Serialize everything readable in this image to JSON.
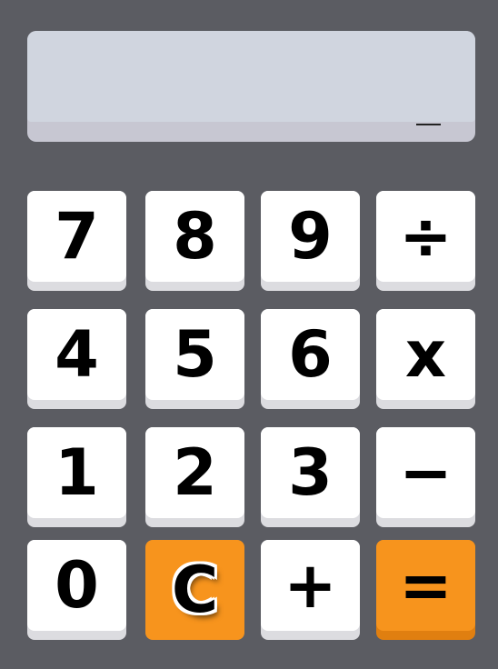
{
  "display": {
    "value": "",
    "cursor": "_"
  },
  "keys": [
    {
      "label": "7"
    },
    {
      "label": "8"
    },
    {
      "label": "9"
    },
    {
      "label": "÷"
    },
    {
      "label": "4"
    },
    {
      "label": "5"
    },
    {
      "label": "6"
    },
    {
      "label": "x"
    },
    {
      "label": "1"
    },
    {
      "label": "2"
    },
    {
      "label": "3"
    },
    {
      "label": "−"
    },
    {
      "label": "0"
    },
    {
      "label": "C"
    },
    {
      "label": "+"
    },
    {
      "label": "="
    }
  ],
  "colors": {
    "background": "#5b5c62",
    "display": "#d0d5df",
    "accent": "#f7941d",
    "key": "#ffffff"
  }
}
